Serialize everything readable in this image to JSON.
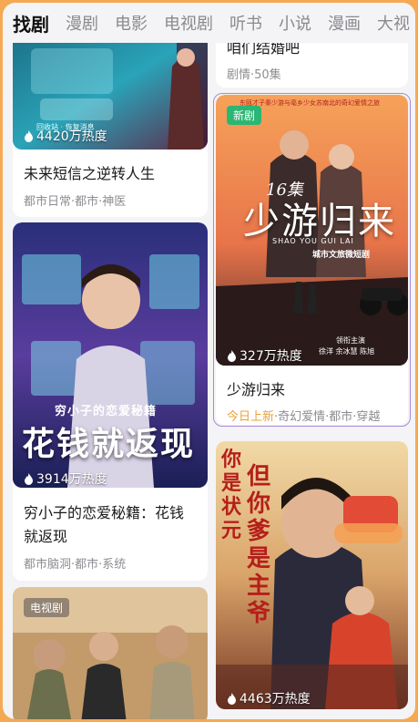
{
  "tabs": [
    {
      "label": "找剧",
      "active": true
    },
    {
      "label": "漫剧"
    },
    {
      "label": "电影"
    },
    {
      "label": "电视剧"
    },
    {
      "label": "听书"
    },
    {
      "label": "小说"
    },
    {
      "label": "漫画"
    },
    {
      "label": "大视"
    }
  ],
  "cards": {
    "left1": {
      "poster_caption": "回收站 · 恢复消息",
      "heat": "4420万热度",
      "title": "未来短信之逆转人生",
      "meta": "都市日常·都市·神医"
    },
    "left2": {
      "poster_overline": "穷小子的恋爱秘籍",
      "poster_title": "花钱就返现",
      "heat": "3914万热度",
      "title_line1": "穷小子的恋爱秘籍：花钱",
      "title_line2": "就返现",
      "meta": "都市脑洞·都市·系统"
    },
    "left3": {
      "badge": "电视剧"
    },
    "right1": {
      "title": "咱们结婚吧",
      "meta": "剧情·50集"
    },
    "right2": {
      "badge": "新剧",
      "poster_tagline": "东瓯才子秦少游与亳乡少女苏南北的奇幻爱情之旅",
      "poster_episodes": "16集",
      "poster_title": "少游归来",
      "poster_pinyin": "SHAO YOU GUI LAI",
      "poster_subtitle": "城市文旅微短剧",
      "poster_cast_label": "领衔主演",
      "poster_cast": "徐洋 余冰慧 陈旭",
      "heat": "327万热度",
      "title": "少游归来",
      "meta_today": "今日上新",
      "meta_rest": "·奇幻爱情·都市·穿越"
    },
    "right3": {
      "poster_title": "你是状元但你爹是主爷",
      "poster_left": "你是状元",
      "poster_right": "但你爹是主爷",
      "heat": "4463万热度"
    }
  },
  "colors": {
    "frame": "#f5a952",
    "accent_today": "#e9a13b",
    "badge_new": "#2bb673",
    "highlight": "#a78ad6"
  }
}
